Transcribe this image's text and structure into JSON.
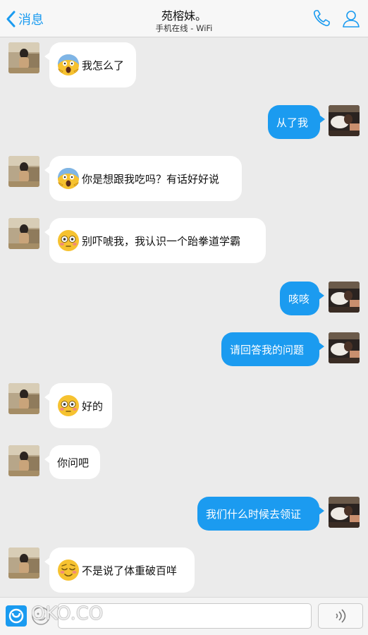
{
  "nav": {
    "back_label": "消息",
    "title": "苑榕妹。",
    "subtitle": "手机在线 - WiFi"
  },
  "messages": [
    {
      "side": "in",
      "text": "我怎么了",
      "emoji": "scream-face"
    },
    {
      "side": "out",
      "text": "从了我"
    },
    {
      "side": "in",
      "text": "你是想跟我吃吗？有话好好说",
      "emoji": "scream-face"
    },
    {
      "side": "in",
      "text": "别吓唬我，我认识一个跆拳道学霸",
      "emoji": "flushed-face"
    },
    {
      "side": "out",
      "text": "咳咳"
    },
    {
      "side": "out",
      "text": "请回答我的问题"
    },
    {
      "side": "in",
      "text": "好的",
      "emoji": "flushed-face"
    },
    {
      "side": "in",
      "text": "你问吧"
    },
    {
      "side": "out",
      "text": "我们什么时候去领证"
    },
    {
      "side": "in",
      "text": "不是说了体重破百咩",
      "emoji": "relieved-face"
    }
  ],
  "input_bar": {
    "watermark": "OKO.CO"
  },
  "colors": {
    "accent": "#1a9bf0",
    "outgoing_bubble": "#1b9bf0",
    "incoming_bubble": "#ffffff",
    "background": "#ebebeb"
  }
}
